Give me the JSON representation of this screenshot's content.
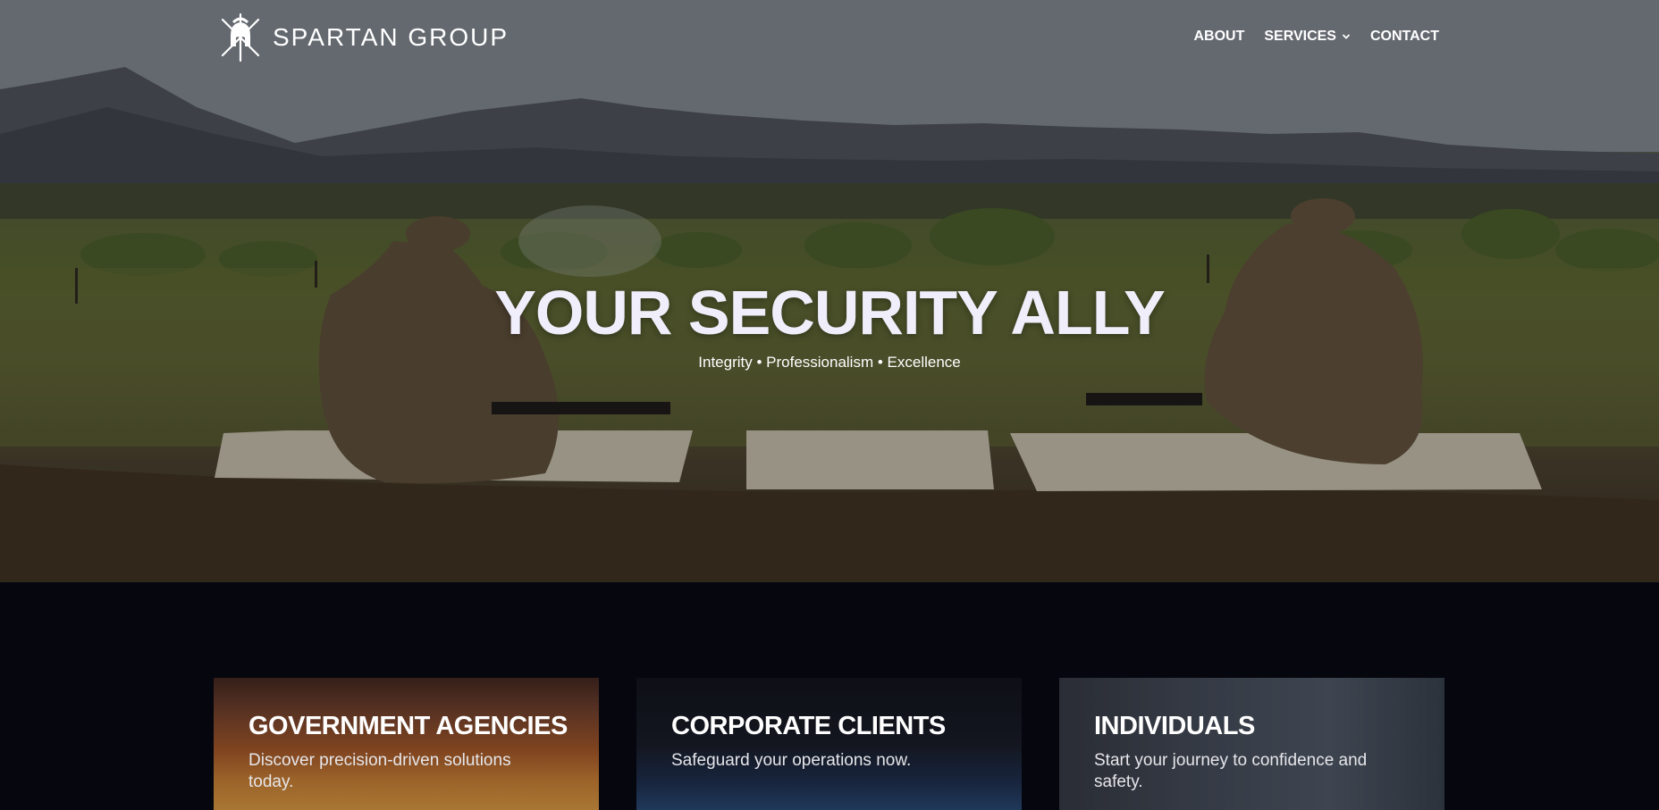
{
  "brand": {
    "name": "SPARTAN GROUP",
    "logo_icon": "spartan-helmet-icon"
  },
  "nav": {
    "items": [
      {
        "label": "ABOUT"
      },
      {
        "label": "SERVICES",
        "icon": "chevron-down-icon"
      },
      {
        "label": "CONTACT"
      }
    ]
  },
  "hero": {
    "title": "YOUR SECURITY ALLY",
    "subtitle": "Integrity • Professionalism • Excellence"
  },
  "cards": [
    {
      "title": "GOVERNMENT AGENCIES",
      "description": "Discover precision-driven solutions today."
    },
    {
      "title": "CORPORATE CLIENTS",
      "description": "Safeguard your operations now."
    },
    {
      "title": "INDIVIDUALS",
      "description": "Start your journey to confidence and safety."
    }
  ],
  "colors": {
    "page_bg": "#05060e",
    "hero_title": "#f1eefb",
    "text": "#ffffff"
  }
}
